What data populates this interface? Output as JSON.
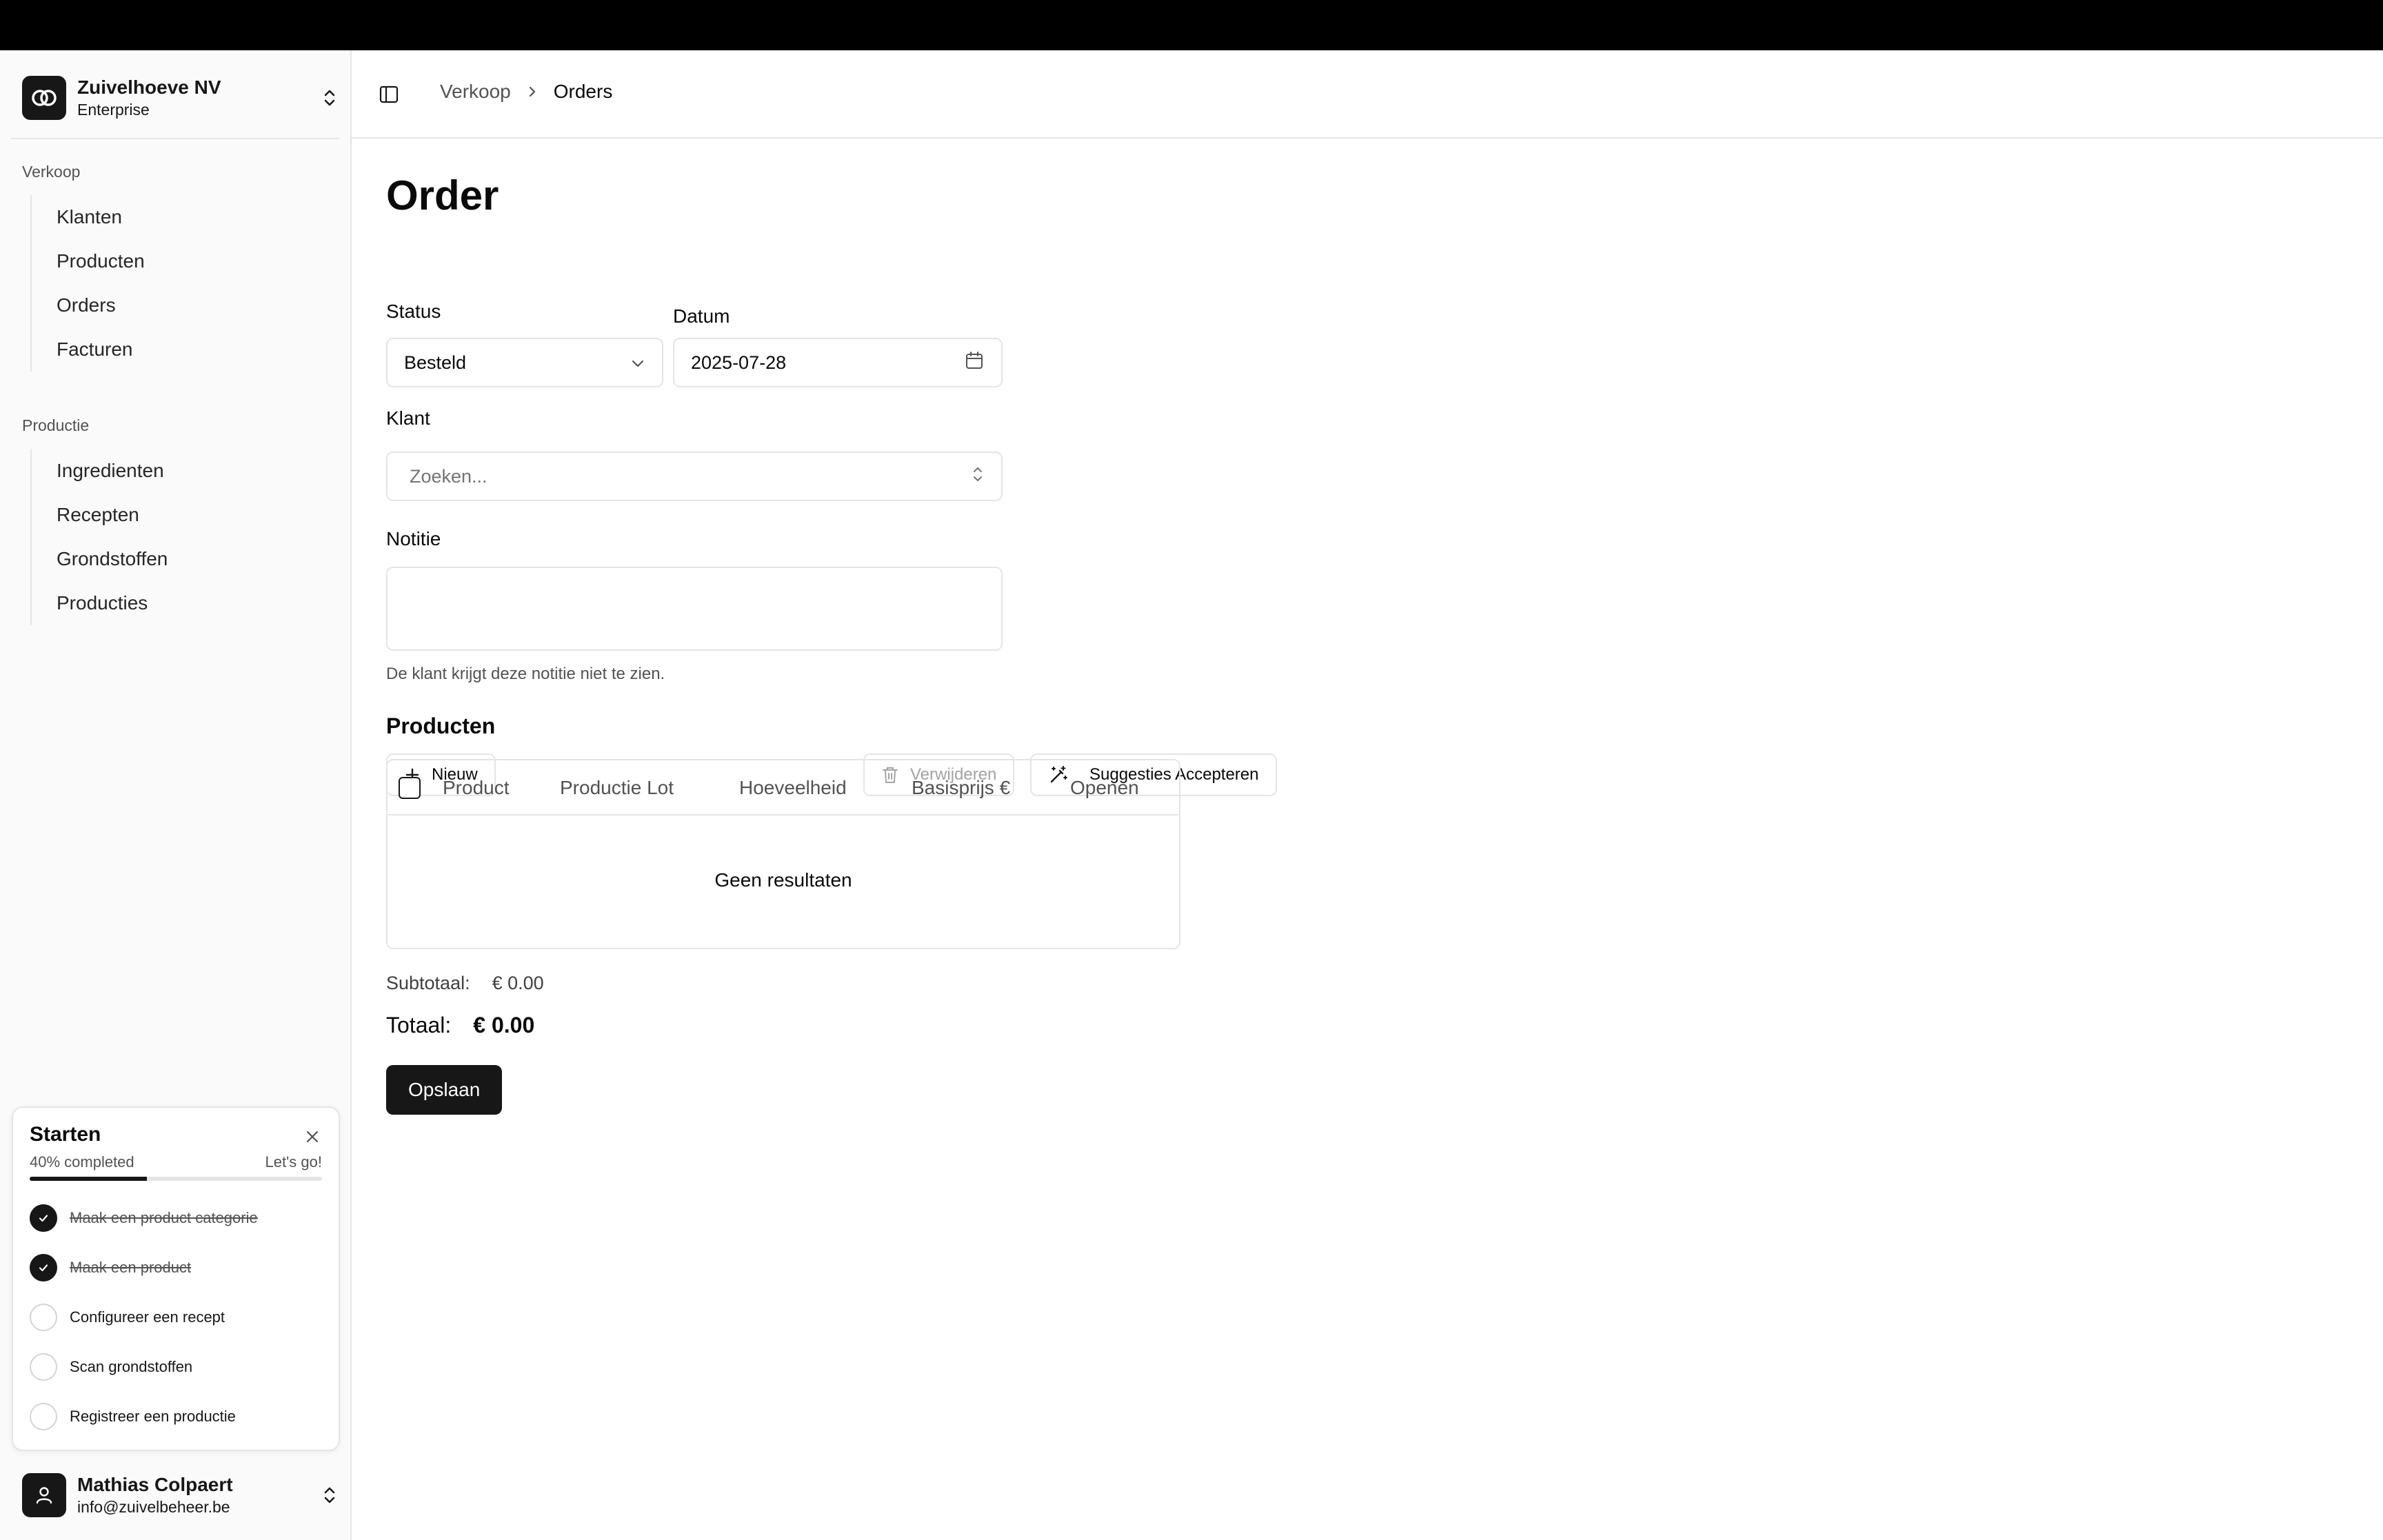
{
  "org": {
    "name": "Zuivelhoeve NV",
    "plan": "Enterprise"
  },
  "sidebar": {
    "groups": [
      {
        "label": "Verkoop",
        "items": [
          "Klanten",
          "Producten",
          "Orders",
          "Facturen"
        ]
      },
      {
        "label": "Productie",
        "items": [
          "Ingredienten",
          "Recepten",
          "Grondstoffen",
          "Producties"
        ]
      }
    ]
  },
  "onboarding": {
    "title": "Starten",
    "progress_text": "40% completed",
    "progress_value": 0.4,
    "cta": "Let's go!",
    "tasks": [
      {
        "label": "Maak een product categorie",
        "done": true
      },
      {
        "label": "Maak een product",
        "done": true
      },
      {
        "label": "Configureer een recept",
        "done": false
      },
      {
        "label": "Scan grondstoffen",
        "done": false
      },
      {
        "label": "Registreer een productie",
        "done": false
      }
    ]
  },
  "user": {
    "name": "Mathias Colpaert",
    "email": "info@zuivelbeheer.be"
  },
  "breadcrumb": {
    "parent": "Verkoop",
    "current": "Orders"
  },
  "form": {
    "title": "Order",
    "status_label": "Status",
    "status_value": "Besteld",
    "date_label": "Datum",
    "date_value": "2025-07-28",
    "customer_label": "Klant",
    "customer_placeholder": "Zoeken...",
    "note_label": "Notitie",
    "note_helper": "De klant krijgt deze notitie niet te zien.",
    "products_title": "Producten"
  },
  "toolbar": {
    "new_label": "Nieuw",
    "delete_label": "Verwijderen",
    "accept_label": "Suggesties Accepteren"
  },
  "table": {
    "columns": [
      "Product",
      "Productie Lot",
      "Hoeveelheid",
      "Basisprijs €",
      "Openen"
    ],
    "empty_text": "Geen resultaten"
  },
  "totals": {
    "subtotal_label": "Subtotaal:",
    "subtotal_value": "€ 0.00",
    "total_label": "Totaal:",
    "total_value": "€ 0.00"
  },
  "save_label": "Opslaan"
}
